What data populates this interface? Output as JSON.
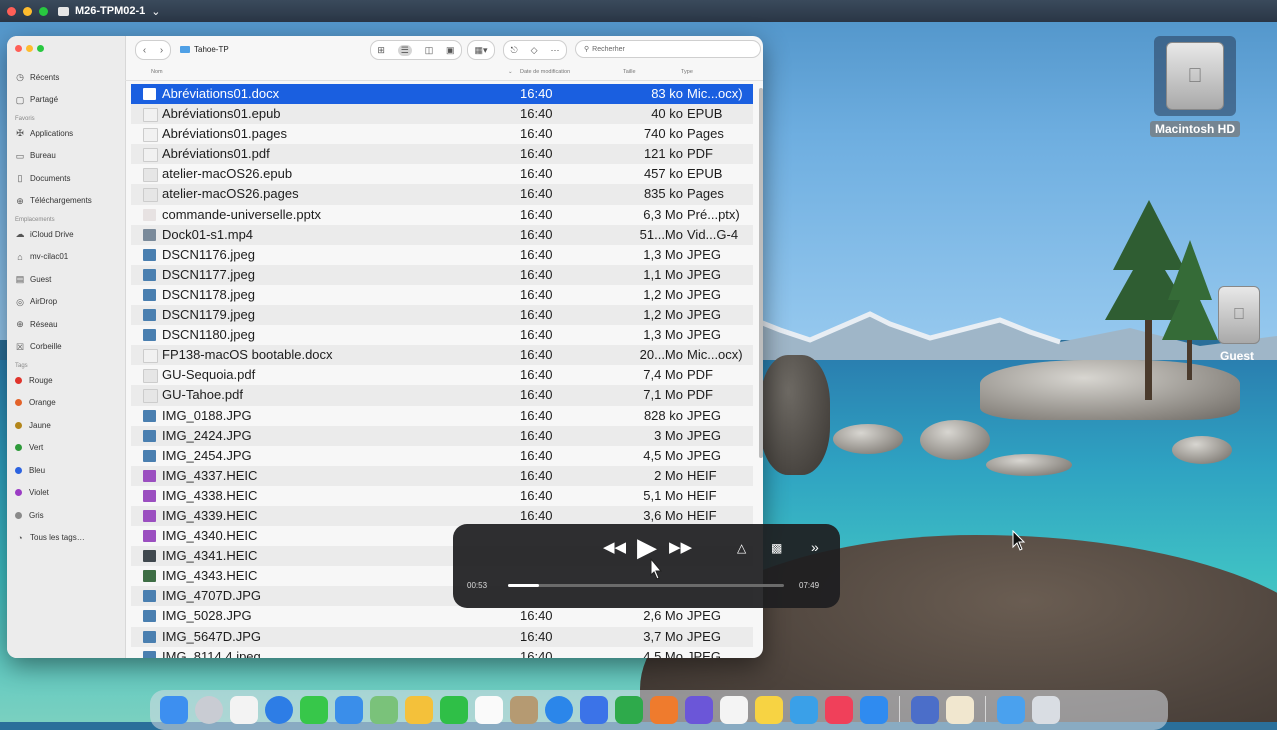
{
  "window_bar": {
    "vm_title": "M26-TPM02-1",
    "chevron": "⌄"
  },
  "desktop": {
    "icons": [
      {
        "label": "Macintosh HD"
      },
      {
        "label": "Guest"
      }
    ]
  },
  "finder": {
    "breadcrumb": "Tahoe-TP",
    "search_placeholder": "Recherher",
    "sidebar": {
      "items_top": [
        {
          "label": "Récents",
          "icon": "clock-icon"
        },
        {
          "label": "Partagé",
          "icon": "shared-folder-icon"
        }
      ],
      "favorites_title": "Favoris",
      "favorites": [
        {
          "label": "Applications",
          "icon": "applications-icon"
        },
        {
          "label": "Bureau",
          "icon": "desktop-icon"
        },
        {
          "label": "Documents",
          "icon": "document-icon"
        },
        {
          "label": "Téléchargements",
          "icon": "download-icon"
        }
      ],
      "locations_title": "Emplacements",
      "locations": [
        {
          "label": "iCloud Drive",
          "icon": "cloud-icon"
        },
        {
          "label": "mv-cilac01",
          "icon": "home-icon"
        },
        {
          "label": "Guest",
          "icon": "drive-icon"
        },
        {
          "label": "AirDrop",
          "icon": "airdrop-icon"
        },
        {
          "label": "Réseau",
          "icon": "network-icon"
        },
        {
          "label": "Corbeille",
          "icon": "trash-icon"
        }
      ],
      "tags_title": "Tags",
      "tags": [
        {
          "label": "Rouge",
          "color": "#e0342b"
        },
        {
          "label": "Orange",
          "color": "#e3632a"
        },
        {
          "label": "Jaune",
          "color": "#b3861b"
        },
        {
          "label": "Vert",
          "color": "#2e9a3a"
        },
        {
          "label": "Bleu",
          "color": "#2c63e0"
        },
        {
          "label": "Violet",
          "color": "#9b3cc4"
        },
        {
          "label": "Gris",
          "color": "#8a8a8a"
        }
      ],
      "all_tags": "Tous les tags…"
    },
    "columns": {
      "name": "Nom",
      "date": "Date de modification",
      "size": "Taille",
      "type": "Type"
    },
    "files": [
      {
        "name": "Abréviations01.docx",
        "date": "16:40",
        "size": "83 ko",
        "type": "Mic...ocx)",
        "icon": "word",
        "selected": true
      },
      {
        "name": "Abréviations01.epub",
        "date": "16:40",
        "size": "40 ko",
        "type": "EPUB",
        "icon": "blank"
      },
      {
        "name": "Abréviations01.pages",
        "date": "16:40",
        "size": "740 ko",
        "type": "Pages",
        "icon": "blank"
      },
      {
        "name": "Abréviations01.pdf",
        "date": "16:40",
        "size": "121 ko",
        "type": "PDF",
        "icon": "blank"
      },
      {
        "name": "atelier-macOS26.epub",
        "date": "16:40",
        "size": "457 ko",
        "type": "EPUB",
        "icon": "doc"
      },
      {
        "name": "atelier-macOS26.pages",
        "date": "16:40",
        "size": "835 ko",
        "type": "Pages",
        "icon": "doc"
      },
      {
        "name": "commande-universelle.pptx",
        "date": "16:40",
        "size": "6,3 Mo",
        "type": "Pré...ptx)",
        "icon": "ppt"
      },
      {
        "name": "Dock01-s1.mp4",
        "date": "16:40",
        "size": "51...Mo",
        "type": "Vid...G-4",
        "icon": "video"
      },
      {
        "name": "DSCN1176.jpeg",
        "date": "16:40",
        "size": "1,3 Mo",
        "type": "JPEG",
        "icon": "photo"
      },
      {
        "name": "DSCN1177.jpeg",
        "date": "16:40",
        "size": "1,1 Mo",
        "type": "JPEG",
        "icon": "photo"
      },
      {
        "name": "DSCN1178.jpeg",
        "date": "16:40",
        "size": "1,2 Mo",
        "type": "JPEG",
        "icon": "photo"
      },
      {
        "name": "DSCN1179.jpeg",
        "date": "16:40",
        "size": "1,2 Mo",
        "type": "JPEG",
        "icon": "photo"
      },
      {
        "name": "DSCN1180.jpeg",
        "date": "16:40",
        "size": "1,3 Mo",
        "type": "JPEG",
        "icon": "photo"
      },
      {
        "name": "FP138-macOS bootable.docx",
        "date": "16:40",
        "size": "20...Mo",
        "type": "Mic...ocx)",
        "icon": "blank"
      },
      {
        "name": "GU-Sequoia.pdf",
        "date": "16:40",
        "size": "7,4 Mo",
        "type": "PDF",
        "icon": "doc"
      },
      {
        "name": "GU-Tahoe.pdf",
        "date": "16:40",
        "size": "7,1 Mo",
        "type": "PDF",
        "icon": "doc"
      },
      {
        "name": "IMG_0188.JPG",
        "date": "16:40",
        "size": "828 ko",
        "type": "JPEG",
        "icon": "photo"
      },
      {
        "name": "IMG_2424.JPG",
        "date": "16:40",
        "size": "3 Mo",
        "type": "JPEG",
        "icon": "photo"
      },
      {
        "name": "IMG_2454.JPG",
        "date": "16:40",
        "size": "4,5 Mo",
        "type": "JPEG",
        "icon": "photo"
      },
      {
        "name": "IMG_4337.HEIC",
        "date": "16:40",
        "size": "2 Mo",
        "type": "HEIF",
        "icon": "heic"
      },
      {
        "name": "IMG_4338.HEIC",
        "date": "16:40",
        "size": "5,1 Mo",
        "type": "HEIF",
        "icon": "heic"
      },
      {
        "name": "IMG_4339.HEIC",
        "date": "16:40",
        "size": "3,6 Mo",
        "type": "HEIF",
        "icon": "heic"
      },
      {
        "name": "IMG_4340.HEIC",
        "date": "",
        "size": "",
        "type": "",
        "icon": "heic"
      },
      {
        "name": "IMG_4341.HEIC",
        "date": "",
        "size": "",
        "type": "",
        "icon": "photo-dark"
      },
      {
        "name": "IMG_4343.HEIC",
        "date": "",
        "size": "",
        "type": "",
        "icon": "photo-green"
      },
      {
        "name": "IMG_4707D.JPG",
        "date": "",
        "size": "",
        "type": "",
        "icon": "photo"
      },
      {
        "name": "IMG_5028.JPG",
        "date": "16:40",
        "size": "2,6 Mo",
        "type": "JPEG",
        "icon": "photo"
      },
      {
        "name": "IMG_5647D.JPG",
        "date": "16:40",
        "size": "3,7 Mo",
        "type": "JPEG",
        "icon": "photo"
      },
      {
        "name": "IMG_8114 4.jpeg",
        "date": "16:40",
        "size": "4,5 Mo",
        "type": "JPEG",
        "icon": "photo"
      }
    ]
  },
  "player": {
    "elapsed": "00:53",
    "total": "07:49",
    "progress": 0.113
  }
}
